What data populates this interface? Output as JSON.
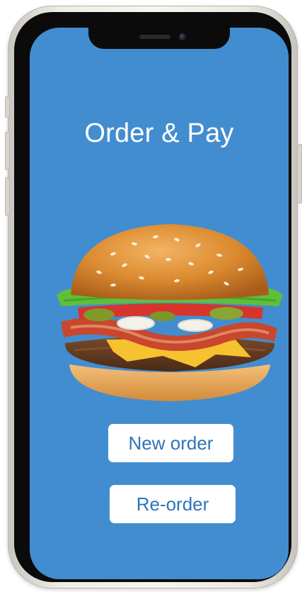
{
  "screen": {
    "title": "Order & Pay",
    "hero_image": "hamburger",
    "background_color": "#428dcf"
  },
  "buttons": {
    "new_order": "New order",
    "reorder": "Re-order",
    "text_color": "#2f74b8"
  },
  "device": {
    "type": "phone",
    "frame_color": "#efece6"
  }
}
